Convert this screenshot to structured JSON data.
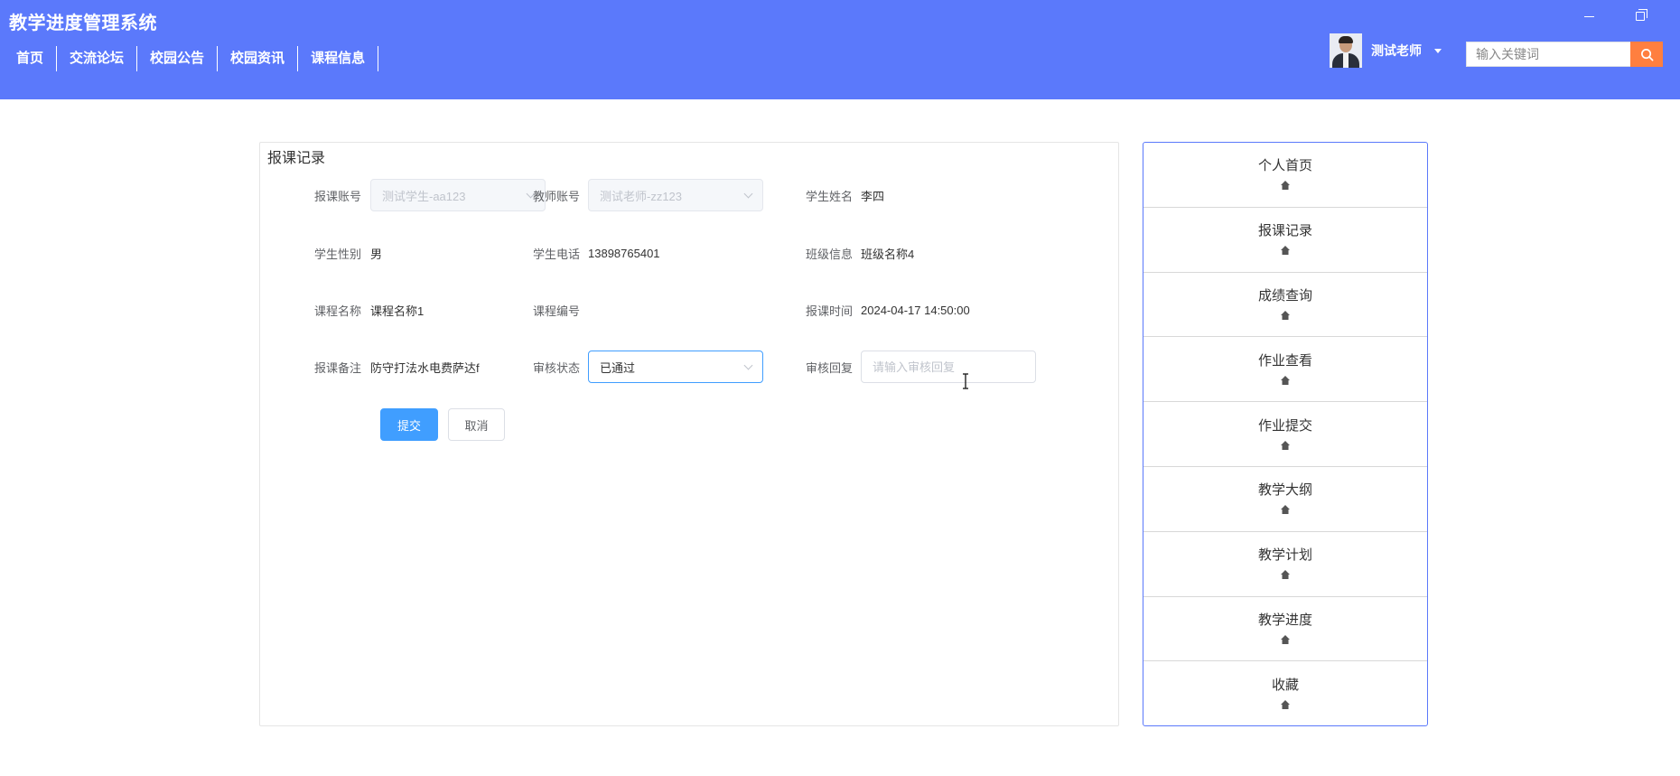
{
  "app": {
    "title": "教学进度管理系统"
  },
  "nav": {
    "items": [
      {
        "label": "首页"
      },
      {
        "label": "交流论坛"
      },
      {
        "label": "校园公告"
      },
      {
        "label": "校园资讯"
      },
      {
        "label": "课程信息"
      }
    ]
  },
  "user": {
    "name": "测试老师"
  },
  "search": {
    "placeholder": "输入关键词"
  },
  "form": {
    "title": "报课记录",
    "fields": {
      "enroll_account": {
        "label": "报课账号",
        "value": "测试学生-aa123"
      },
      "teacher_account": {
        "label": "教师账号",
        "value": "测试老师-zz123"
      },
      "student_name": {
        "label": "学生姓名",
        "value": "李四"
      },
      "student_gender": {
        "label": "学生性别",
        "value": "男"
      },
      "student_phone": {
        "label": "学生电话",
        "value": "13898765401"
      },
      "class_info": {
        "label": "班级信息",
        "value": "班级名称4"
      },
      "course_name": {
        "label": "课程名称",
        "value": "课程名称1"
      },
      "course_code": {
        "label": "课程编号",
        "value": ""
      },
      "enroll_time": {
        "label": "报课时间",
        "value": "2024-04-17 14:50:00"
      },
      "enroll_note": {
        "label": "报课备注",
        "value": "防守打法水电费萨达f"
      },
      "review_status": {
        "label": "审核状态",
        "value": "已通过"
      },
      "review_reply": {
        "label": "审核回复",
        "placeholder": "请输入审核回复"
      }
    },
    "submit_label": "提交",
    "cancel_label": "取消"
  },
  "side_menu": {
    "items": [
      {
        "label": "个人首页",
        "icon": "home-icon"
      },
      {
        "label": "报课记录",
        "icon": "home-icon"
      },
      {
        "label": "成绩查询",
        "icon": "home-icon"
      },
      {
        "label": "作业查看",
        "icon": "home-icon"
      },
      {
        "label": "作业提交",
        "icon": "home-icon"
      },
      {
        "label": "教学大纲",
        "icon": "home-icon"
      },
      {
        "label": "教学计划",
        "icon": "home-icon"
      },
      {
        "label": "教学进度",
        "icon": "home-icon"
      },
      {
        "label": "收藏",
        "icon": "home-icon"
      }
    ]
  },
  "colors": {
    "header_bg": "#5b79fb",
    "primary": "#409eff",
    "search_button": "#ff7f3f",
    "side_border": "#5b79fb"
  }
}
